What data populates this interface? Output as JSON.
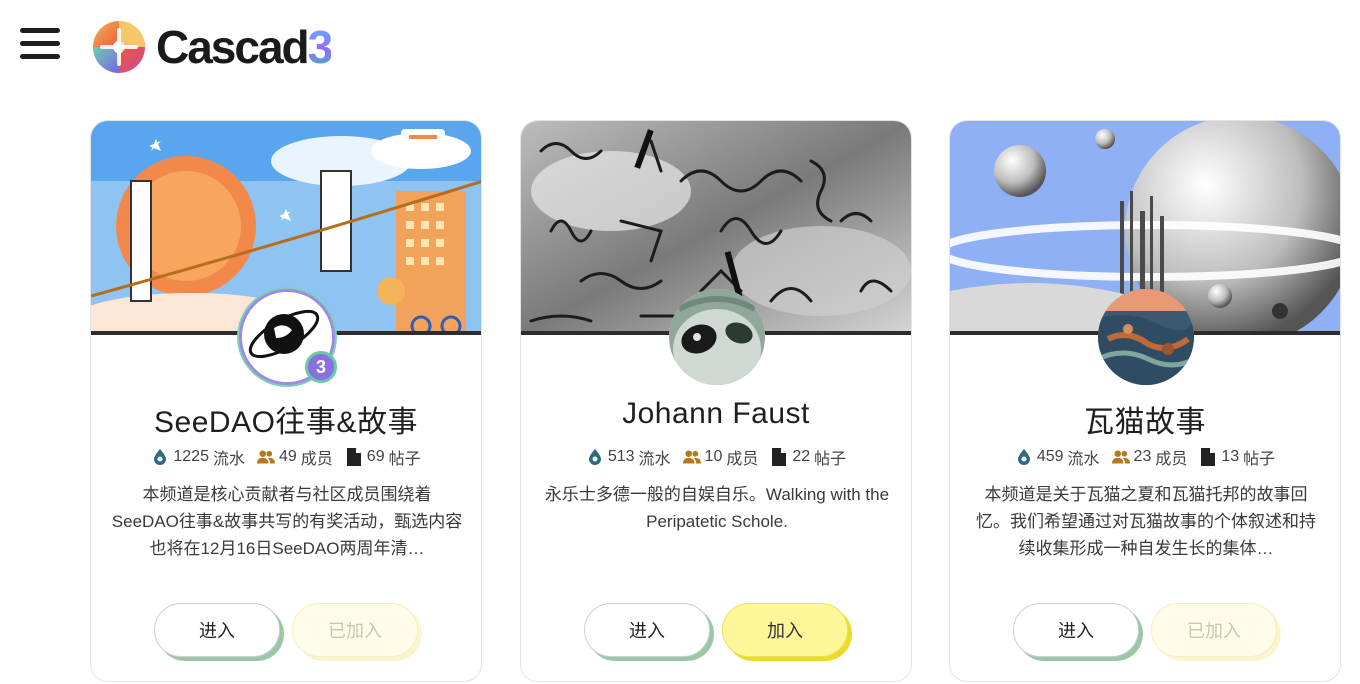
{
  "brand": {
    "name_prefix": "Cascad",
    "name_suffix": "3"
  },
  "icons": {
    "menu": "hamburger-menu-icon",
    "flow": "flow-icon",
    "members": "members-icon",
    "posts": "document-icon"
  },
  "colors": {
    "enter_shadow": "#9cc7a7",
    "join_bg": "#fdf79a",
    "joined_bg": "#fffcea"
  },
  "cards": [
    {
      "title": "SeeDAO往事&故事",
      "flow": "1225",
      "flow_label": "流水",
      "members": "49",
      "members_label": "成员",
      "posts": "69",
      "posts_label": "帖子",
      "description": "本频道是核心贡献者与社区成员围绕着SeeDAO往事&故事共写的有奖活动，甄选内容也将在12月16日SeeDAO两周年清…",
      "enter_label": "进入",
      "join_label": "已加入",
      "joined": true,
      "avatar_badge": "3"
    },
    {
      "title": "Johann Faust",
      "flow": "513",
      "flow_label": "流水",
      "members": "10",
      "members_label": "成员",
      "posts": "22",
      "posts_label": "帖子",
      "description": "永乐士多德一般的自娱自乐。Walking with the Peripatetic Schole.",
      "enter_label": "进入",
      "join_label": "加入",
      "joined": false
    },
    {
      "title": "瓦猫故事",
      "flow": "459",
      "flow_label": "流水",
      "members": "23",
      "members_label": "成员",
      "posts": "13",
      "posts_label": "帖子",
      "description": "本频道是关于瓦猫之夏和瓦猫托邦的故事回忆。我们希望通过对瓦猫故事的个体叙述和持续收集形成一种自发生长的集体…",
      "enter_label": "进入",
      "join_label": "已加入",
      "joined": true
    }
  ]
}
